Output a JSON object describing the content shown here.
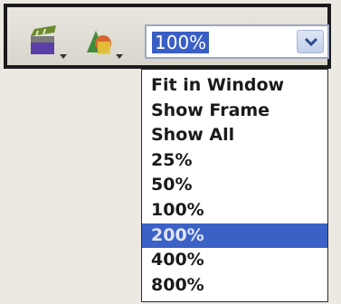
{
  "toolbar": {
    "buttons": [
      {
        "name": "edit-scene",
        "icon": "clapperboard-icon"
      },
      {
        "name": "edit-symbols",
        "icon": "shapes-icon"
      }
    ],
    "zoom": {
      "value": "100%",
      "arrow_icon": "chevron-down-icon"
    }
  },
  "dropdown": {
    "items": [
      "Fit in Window",
      "Show Frame",
      "Show All",
      "25%",
      "50%",
      "100%",
      "200%",
      "400%",
      "800%"
    ],
    "highlighted": "200%"
  },
  "colors": {
    "selection": "#3c61c6",
    "frame": "#1a1a1a",
    "toolbar_bg": "#e2dfd7"
  }
}
